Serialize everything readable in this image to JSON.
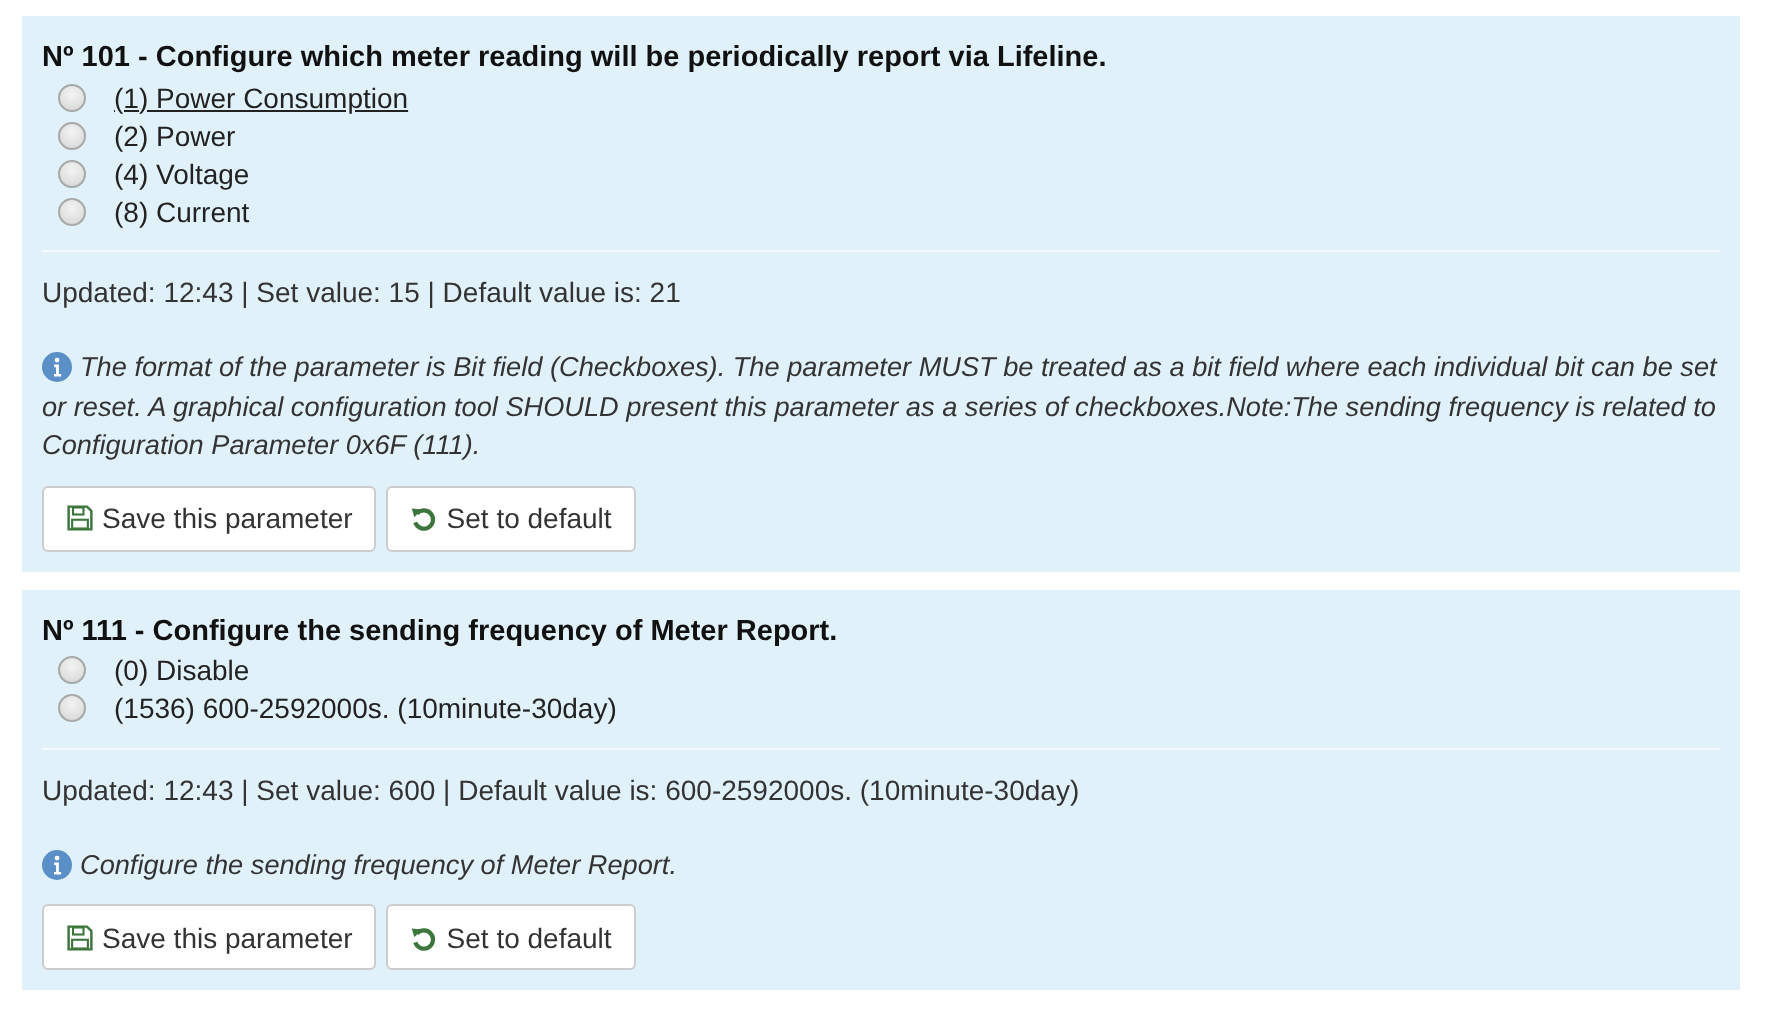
{
  "parameters": [
    {
      "title": "Nº 101 - Configure which meter reading will be periodically report via Lifeline.",
      "options": [
        {
          "label": "(1) Power Consumption",
          "selected": false,
          "underlined": true
        },
        {
          "label": "(2) Power",
          "selected": false,
          "underlined": false
        },
        {
          "label": "(4) Voltage",
          "selected": false,
          "underlined": false
        },
        {
          "label": "(8) Current",
          "selected": false,
          "underlined": false
        }
      ],
      "status": "Updated: 12:43 | Set value: 15 | Default value is: 21",
      "info": "The format of the parameter is Bit field (Checkboxes). The parameter MUST be treated as a bit field where each individual bit can be set or reset. A graphical configuration tool SHOULD present this parameter as a series of checkboxes.Note:The sending frequency is related to Configuration Parameter 0x6F (111).",
      "buttons": [
        {
          "kind": "save",
          "label": "Save this parameter"
        },
        {
          "kind": "reset",
          "label": "Set to default"
        }
      ]
    },
    {
      "title": "Nº 111 - Configure the sending frequency of Meter Report.",
      "options": [
        {
          "label": "(0) Disable",
          "selected": false,
          "underlined": false
        },
        {
          "label": "(1536) 600-2592000s. (10minute-30day)",
          "selected": false,
          "underlined": false
        }
      ],
      "status": "Updated: 12:43 | Set value: 600 | Default value is: 600-2592000s. (10minute-30day)",
      "info": "Configure the sending frequency of Meter Report.",
      "buttons": [
        {
          "kind": "save",
          "label": "Save this parameter"
        },
        {
          "kind": "reset",
          "label": "Set to default"
        }
      ]
    }
  ]
}
